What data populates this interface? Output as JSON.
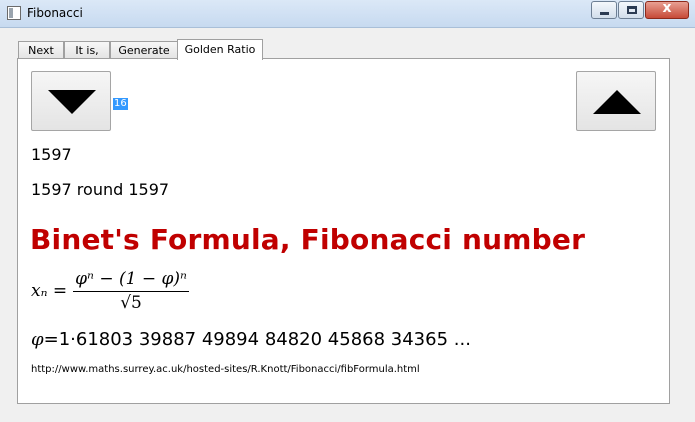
{
  "window": {
    "title": "Fibonacci",
    "close_glyph": "x"
  },
  "tabs": [
    {
      "label": "Next"
    },
    {
      "label": "It is,"
    },
    {
      "label": "Generate"
    },
    {
      "label": "Golden Ratio"
    }
  ],
  "active_tab": "Golden Ratio",
  "spin": {
    "value": "16"
  },
  "fib": {
    "value": "1597"
  },
  "round_line": "1597 round 1597",
  "heading": "Binet's Formula, Fibonacci number",
  "formula": {
    "lhs": "xₙ =",
    "numerator": "φⁿ − (1 − φ)ⁿ",
    "denominator": "√5"
  },
  "phi_line": {
    "symbol": "φ",
    "text": "=1·61803 39887 49894 84820 45868 34365 ..."
  },
  "url": "http://www.maths.surrey.ac.uk/hosted-sites/R.Knott/Fibonacci/fibFormula.html",
  "icons": [
    "app-icon",
    "minimize-icon",
    "maximize-icon",
    "close-icon",
    "triangle-down-icon",
    "triangle-up-icon"
  ]
}
